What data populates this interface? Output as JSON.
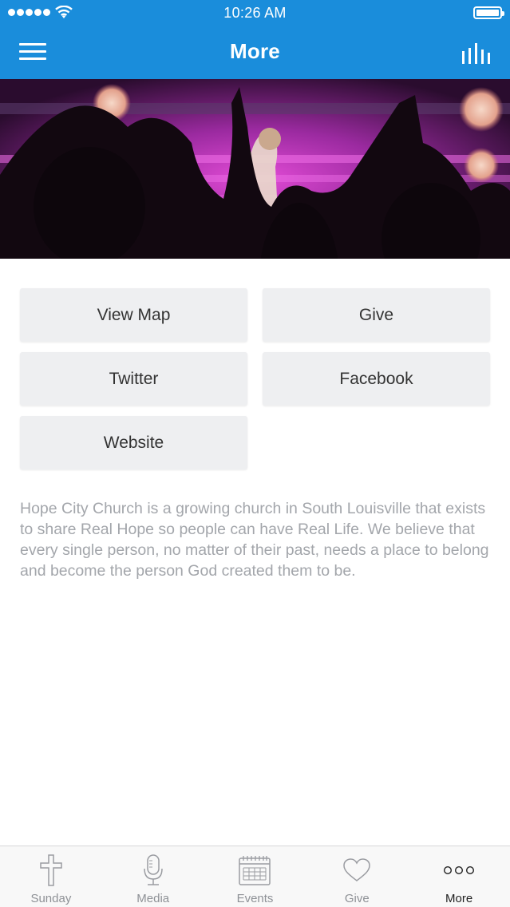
{
  "status_bar": {
    "time": "10:26 AM"
  },
  "nav": {
    "title": "More"
  },
  "buttons": {
    "view_map": "View Map",
    "give": "Give",
    "twitter": "Twitter",
    "facebook": "Facebook",
    "website": "Website"
  },
  "description": "Hope City Church is a growing church in South Louisville that exists to share Real Hope so people can have Real Life. We believe that every single person, no matter of their past, needs a place to belong and become the person God created them to be.",
  "tabs": [
    {
      "label": "Sunday",
      "icon": "cross-icon",
      "active": false
    },
    {
      "label": "Media",
      "icon": "microphone-icon",
      "active": false
    },
    {
      "label": "Events",
      "icon": "calendar-icon",
      "active": false
    },
    {
      "label": "Give",
      "icon": "heart-icon",
      "active": false
    },
    {
      "label": "More",
      "icon": "more-dots-icon",
      "active": true
    }
  ],
  "colors": {
    "brand_blue": "#1a8ddb",
    "button_bg": "#eeeff1",
    "description_text": "#a3a6ab",
    "tab_inactive": "#8e9196",
    "tab_active": "#222222"
  }
}
